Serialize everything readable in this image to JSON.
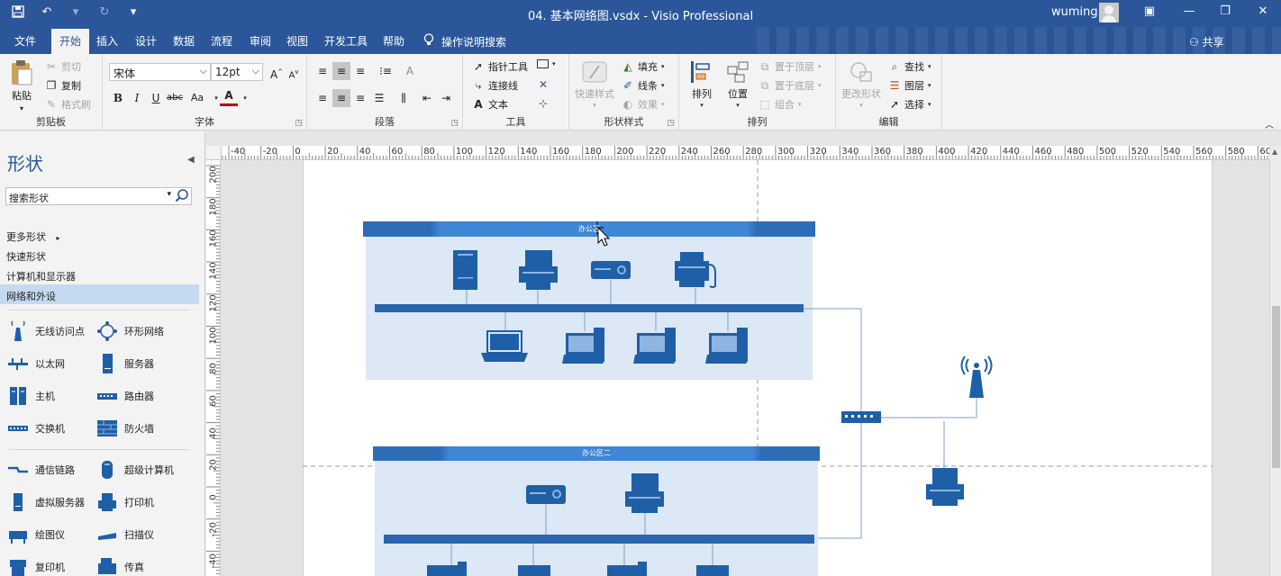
{
  "window": {
    "title": "04. 基本网络图.vsdx  -  Visio Professional",
    "user": "wuming"
  },
  "tabs": [
    "文件",
    "开始",
    "插入",
    "设计",
    "数据",
    "流程",
    "审阅",
    "视图",
    "开发工具",
    "帮助"
  ],
  "tell_me": "操作说明搜索",
  "share": "共享",
  "ribbon": {
    "clipboard": {
      "label": "剪贴板",
      "paste": "粘贴",
      "cut": "剪切",
      "copy": "复制",
      "format_painter": "格式刷"
    },
    "font": {
      "label": "字体",
      "font_name": "宋体",
      "font_size": "12pt",
      "bold": "B",
      "italic": "I",
      "underline": "U",
      "strike": "abc",
      "case": "Aa",
      "font_color": "A"
    },
    "paragraph": {
      "label": "段落"
    },
    "tools": {
      "label": "工具",
      "pointer": "指针工具",
      "connector": "连接线",
      "text": "文本"
    },
    "shape_styles": {
      "label": "形状样式",
      "quick_styles": "快速样式",
      "fill": "填充",
      "line": "线条",
      "effects": "效果"
    },
    "arrange": {
      "label": "排列",
      "arrange": "排列",
      "position": "位置",
      "bring_front": "置于顶层",
      "send_back": "置于底层",
      "group": "组合"
    },
    "editing": {
      "label": "编辑",
      "change_shape": "更改形状",
      "find": "查找",
      "layers": "图层",
      "select": "选择"
    }
  },
  "shapes_pane": {
    "title": "形状",
    "search_placeholder": "搜索形状",
    "nav": [
      "更多形状",
      "快速形状",
      "计算机和显示器",
      "网络和外设"
    ],
    "selected_nav": "网络和外设",
    "stencils": [
      [
        "无线访问点",
        "环形网络"
      ],
      [
        "以太网",
        "服务器"
      ],
      [
        "主机",
        "路由器"
      ],
      [
        "交换机",
        "防火墙"
      ],
      [
        "通信链路",
        "超级计算机"
      ],
      [
        "虚拟服务器",
        "打印机"
      ],
      [
        "绘图仪",
        "扫描仪"
      ],
      [
        "复印机",
        "传真"
      ]
    ]
  },
  "ruler": {
    "h_labels": [
      "-40",
      "-20",
      "0",
      "20",
      "40",
      "60",
      "80",
      "100",
      "120",
      "140",
      "160",
      "180",
      "200",
      "220",
      "240",
      "260",
      "280",
      "300",
      "320",
      "340",
      "360",
      "380",
      "400",
      "420",
      "440",
      "460",
      "480",
      "500",
      "520",
      "540",
      "560",
      "580",
      "60"
    ],
    "v_labels": [
      "200",
      "180",
      "160",
      "140",
      "120",
      "100",
      "80",
      "60",
      "40",
      "20",
      "0",
      "-20",
      "-40"
    ]
  },
  "diagram": {
    "office1_title": "办公区",
    "office2_title": "办公区二"
  },
  "colors": {
    "title_bar": "#2b579a",
    "ribbon_bg": "#f3f3f3",
    "zone_fill": "#dce8f5",
    "zone_header": "#2e75c4",
    "device": "#1f5fa8",
    "connector": "#7f9fc4"
  }
}
